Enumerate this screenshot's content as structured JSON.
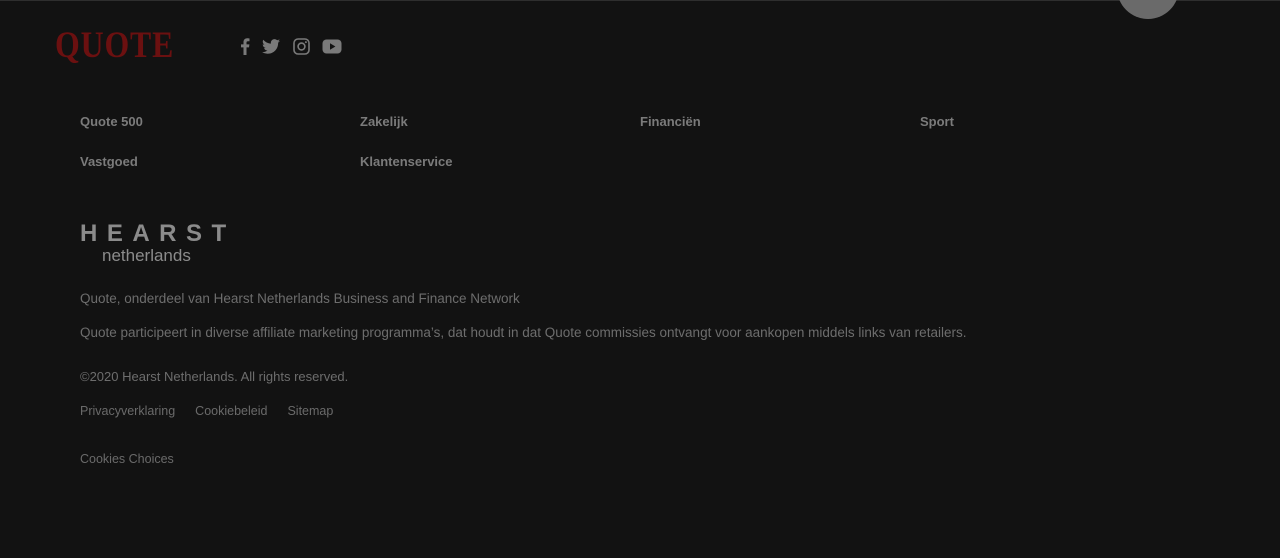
{
  "brand": {
    "logo_text": "QUOTE",
    "logo_color": "#6b1010",
    "background": "#121212"
  },
  "social": [
    {
      "name": "facebook-icon",
      "label": "f"
    },
    {
      "name": "twitter-icon",
      "label": "twitter"
    },
    {
      "name": "instagram-icon",
      "label": "instagram"
    },
    {
      "name": "youtube-icon",
      "label": "youtube"
    }
  ],
  "nav": {
    "items": [
      {
        "label": "Quote 500"
      },
      {
        "label": "Zakelijk"
      },
      {
        "label": "Financiën"
      },
      {
        "label": "Sport"
      },
      {
        "label": "Vastgoed"
      },
      {
        "label": "Klantenservice"
      }
    ]
  },
  "hearst": {
    "word": "HEARST",
    "sub": "netherlands"
  },
  "footer": {
    "description_1": "Quote, onderdeel van Hearst Netherlands Business and Finance Network",
    "description_2": "Quote participeert in diverse affiliate marketing programma’s, dat houdt in dat Quote commissies ontvangt voor aankopen middels links van retailers.",
    "copyright": "©2020 Hearst Netherlands. All rights reserved.",
    "links": [
      {
        "label": "Privacyverklaring"
      },
      {
        "label": "Cookiebeleid"
      },
      {
        "label": "Sitemap"
      }
    ],
    "cookies_choices": "Cookies Choices"
  }
}
